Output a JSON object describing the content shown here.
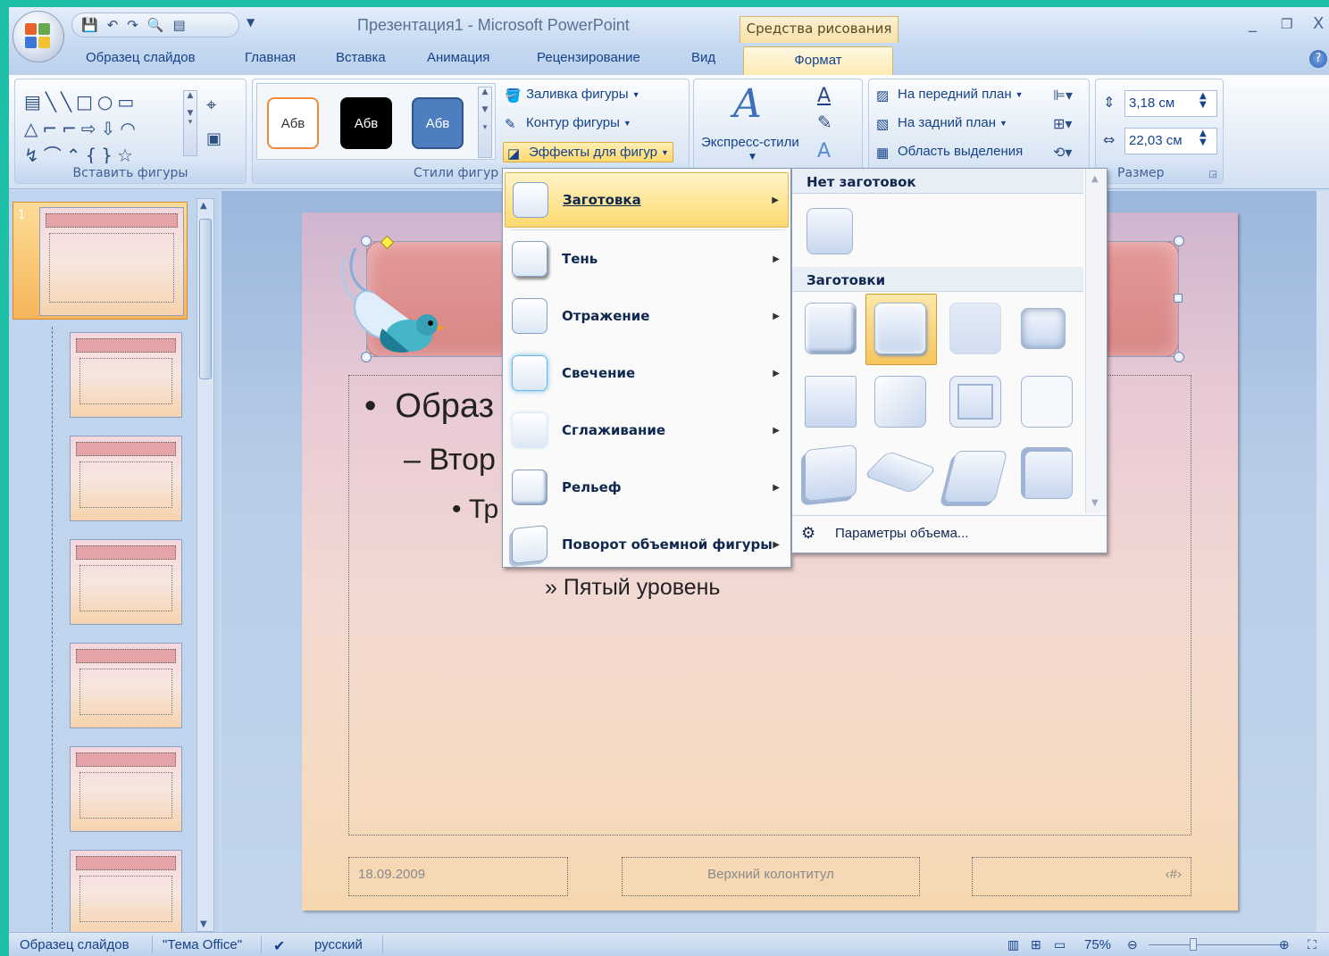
{
  "window": {
    "title": "Презентация1 - Microsoft PowerPoint",
    "context_tab_group": "Средства рисования",
    "minimize": "_",
    "restore": "❐",
    "close": "X"
  },
  "tabs": [
    "Образец слайдов",
    "Главная",
    "Вставка",
    "Анимация",
    "Рецензирование",
    "Вид",
    "Формат"
  ],
  "active_tab": "Формат",
  "ribbon": {
    "groups": {
      "insert_shapes": "Вставить фигуры",
      "shape_styles": "Стили фигур",
      "size": "Размер"
    },
    "style_samples": [
      "Абв",
      "Абв",
      "Абв"
    ],
    "shape_fill": "Заливка фигуры",
    "shape_outline": "Контур фигуры",
    "shape_effects": "Эффекты для фигур",
    "wordart_quick_styles": "Экспресс-стили",
    "bring_to_front": "На передний план",
    "send_to_back": "На задний план",
    "selection_pane": "Область выделения",
    "height": "3,18 см",
    "width": "22,03 см"
  },
  "effects_menu": {
    "items": [
      {
        "label": "Заготовка",
        "hot": true
      },
      {
        "label": "Тень"
      },
      {
        "label": "Отражение"
      },
      {
        "label": "Свечение"
      },
      {
        "label": "Сглаживание"
      },
      {
        "label": "Рельеф"
      },
      {
        "label": "Поворот объемной фигуры"
      }
    ]
  },
  "preset_submenu": {
    "no_preset_header": "Нет заготовок",
    "presets_header": "Заготовки",
    "options_link": "Параметры объема..."
  },
  "slide": {
    "level1": "Образ",
    "level2": "Втор",
    "level3": "Тр",
    "level5": "Пятый уровень",
    "footer_date": "18.09.2009",
    "footer_center": "Верхний колонтитул",
    "footer_num": "‹#›"
  },
  "thumbnails": {
    "selected_number": "1",
    "count": 7
  },
  "status": {
    "view": "Образец слайдов",
    "theme": "\"Тема Office\"",
    "language": "русский",
    "zoom": "75%"
  },
  "colors": {
    "accent_hot": "#fdd96f",
    "title_shape": "#d98585"
  }
}
